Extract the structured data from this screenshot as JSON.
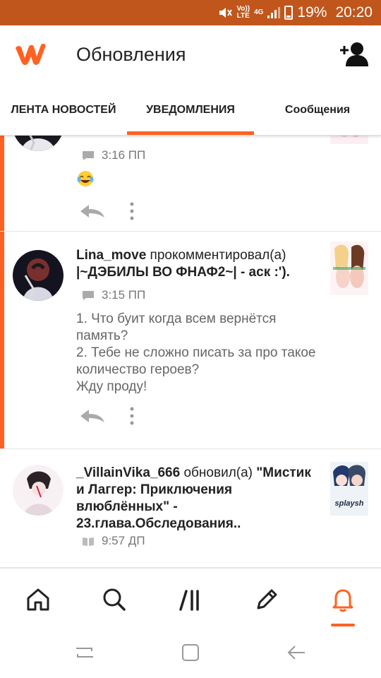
{
  "status_bar": {
    "network_top": "Vo))",
    "network_bottom": "LTE",
    "network_type": "4G",
    "battery": "19%",
    "time": "20:20"
  },
  "header": {
    "title": "Обновления",
    "logo_icon": "wattpad-w-logo",
    "action_icon": "add-user-icon"
  },
  "tabs": [
    {
      "label": "ЛЕНТА НОВОСТЕЙ",
      "active": false
    },
    {
      "label": "УВЕДОМЛЕНИЯ",
      "active": true
    },
    {
      "label": "Сообщения",
      "active": false
    }
  ],
  "feed": [
    {
      "time": "3:16 ПП",
      "meta_icon": "comment-icon",
      "content_emoji": "laughing-tears-emoji",
      "unread": true
    },
    {
      "user": "Lina_move",
      "action": " прокомментировал(а) ",
      "story": "|~ДЭБИЛЫ ВО ФНАФ2~| - аск :').",
      "time": "3:15 ПП",
      "meta_icon": "comment-icon",
      "body": "1. Что буит когда всем вернётся память?\n2. Тебе не сложно писать за про такое количество героев?\nЖду проду!",
      "unread": true
    },
    {
      "user": "_VillainVika_666",
      "action": " обновил(а) ",
      "story": "\"Мистик и Лаггер: Приключения влюблённых\" - 23.глава.Обследования..",
      "time": "9:57 ДП",
      "meta_icon": "book-icon",
      "unread": false
    }
  ],
  "bottom_nav": [
    {
      "icon": "home-icon",
      "active": false
    },
    {
      "icon": "search-icon",
      "active": false
    },
    {
      "icon": "library-icon",
      "active": false
    },
    {
      "icon": "pencil-icon",
      "active": false
    },
    {
      "icon": "bell-icon",
      "active": true
    }
  ],
  "colors": {
    "accent": "#ff6122",
    "status_bar": "#c0561c"
  }
}
